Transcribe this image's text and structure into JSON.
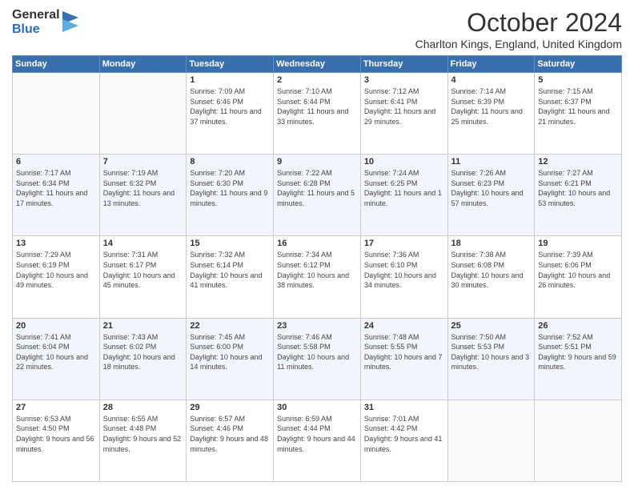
{
  "logo": {
    "general": "General",
    "blue": "Blue"
  },
  "header": {
    "month": "October 2024",
    "location": "Charlton Kings, England, United Kingdom"
  },
  "days": [
    "Sunday",
    "Monday",
    "Tuesday",
    "Wednesday",
    "Thursday",
    "Friday",
    "Saturday"
  ],
  "weeks": [
    [
      {
        "day": "",
        "sunrise": "",
        "sunset": "",
        "daylight": ""
      },
      {
        "day": "",
        "sunrise": "",
        "sunset": "",
        "daylight": ""
      },
      {
        "day": "1",
        "sunrise": "Sunrise: 7:09 AM",
        "sunset": "Sunset: 6:46 PM",
        "daylight": "Daylight: 11 hours and 37 minutes."
      },
      {
        "day": "2",
        "sunrise": "Sunrise: 7:10 AM",
        "sunset": "Sunset: 6:44 PM",
        "daylight": "Daylight: 11 hours and 33 minutes."
      },
      {
        "day": "3",
        "sunrise": "Sunrise: 7:12 AM",
        "sunset": "Sunset: 6:41 PM",
        "daylight": "Daylight: 11 hours and 29 minutes."
      },
      {
        "day": "4",
        "sunrise": "Sunrise: 7:14 AM",
        "sunset": "Sunset: 6:39 PM",
        "daylight": "Daylight: 11 hours and 25 minutes."
      },
      {
        "day": "5",
        "sunrise": "Sunrise: 7:15 AM",
        "sunset": "Sunset: 6:37 PM",
        "daylight": "Daylight: 11 hours and 21 minutes."
      }
    ],
    [
      {
        "day": "6",
        "sunrise": "Sunrise: 7:17 AM",
        "sunset": "Sunset: 6:34 PM",
        "daylight": "Daylight: 11 hours and 17 minutes."
      },
      {
        "day": "7",
        "sunrise": "Sunrise: 7:19 AM",
        "sunset": "Sunset: 6:32 PM",
        "daylight": "Daylight: 11 hours and 13 minutes."
      },
      {
        "day": "8",
        "sunrise": "Sunrise: 7:20 AM",
        "sunset": "Sunset: 6:30 PM",
        "daylight": "Daylight: 11 hours and 9 minutes."
      },
      {
        "day": "9",
        "sunrise": "Sunrise: 7:22 AM",
        "sunset": "Sunset: 6:28 PM",
        "daylight": "Daylight: 11 hours and 5 minutes."
      },
      {
        "day": "10",
        "sunrise": "Sunrise: 7:24 AM",
        "sunset": "Sunset: 6:25 PM",
        "daylight": "Daylight: 11 hours and 1 minute."
      },
      {
        "day": "11",
        "sunrise": "Sunrise: 7:26 AM",
        "sunset": "Sunset: 6:23 PM",
        "daylight": "Daylight: 10 hours and 57 minutes."
      },
      {
        "day": "12",
        "sunrise": "Sunrise: 7:27 AM",
        "sunset": "Sunset: 6:21 PM",
        "daylight": "Daylight: 10 hours and 53 minutes."
      }
    ],
    [
      {
        "day": "13",
        "sunrise": "Sunrise: 7:29 AM",
        "sunset": "Sunset: 6:19 PM",
        "daylight": "Daylight: 10 hours and 49 minutes."
      },
      {
        "day": "14",
        "sunrise": "Sunrise: 7:31 AM",
        "sunset": "Sunset: 6:17 PM",
        "daylight": "Daylight: 10 hours and 45 minutes."
      },
      {
        "day": "15",
        "sunrise": "Sunrise: 7:32 AM",
        "sunset": "Sunset: 6:14 PM",
        "daylight": "Daylight: 10 hours and 41 minutes."
      },
      {
        "day": "16",
        "sunrise": "Sunrise: 7:34 AM",
        "sunset": "Sunset: 6:12 PM",
        "daylight": "Daylight: 10 hours and 38 minutes."
      },
      {
        "day": "17",
        "sunrise": "Sunrise: 7:36 AM",
        "sunset": "Sunset: 6:10 PM",
        "daylight": "Daylight: 10 hours and 34 minutes."
      },
      {
        "day": "18",
        "sunrise": "Sunrise: 7:38 AM",
        "sunset": "Sunset: 6:08 PM",
        "daylight": "Daylight: 10 hours and 30 minutes."
      },
      {
        "day": "19",
        "sunrise": "Sunrise: 7:39 AM",
        "sunset": "Sunset: 6:06 PM",
        "daylight": "Daylight: 10 hours and 26 minutes."
      }
    ],
    [
      {
        "day": "20",
        "sunrise": "Sunrise: 7:41 AM",
        "sunset": "Sunset: 6:04 PM",
        "daylight": "Daylight: 10 hours and 22 minutes."
      },
      {
        "day": "21",
        "sunrise": "Sunrise: 7:43 AM",
        "sunset": "Sunset: 6:02 PM",
        "daylight": "Daylight: 10 hours and 18 minutes."
      },
      {
        "day": "22",
        "sunrise": "Sunrise: 7:45 AM",
        "sunset": "Sunset: 6:00 PM",
        "daylight": "Daylight: 10 hours and 14 minutes."
      },
      {
        "day": "23",
        "sunrise": "Sunrise: 7:46 AM",
        "sunset": "Sunset: 5:58 PM",
        "daylight": "Daylight: 10 hours and 11 minutes."
      },
      {
        "day": "24",
        "sunrise": "Sunrise: 7:48 AM",
        "sunset": "Sunset: 5:55 PM",
        "daylight": "Daylight: 10 hours and 7 minutes."
      },
      {
        "day": "25",
        "sunrise": "Sunrise: 7:50 AM",
        "sunset": "Sunset: 5:53 PM",
        "daylight": "Daylight: 10 hours and 3 minutes."
      },
      {
        "day": "26",
        "sunrise": "Sunrise: 7:52 AM",
        "sunset": "Sunset: 5:51 PM",
        "daylight": "Daylight: 9 hours and 59 minutes."
      }
    ],
    [
      {
        "day": "27",
        "sunrise": "Sunrise: 6:53 AM",
        "sunset": "Sunset: 4:50 PM",
        "daylight": "Daylight: 9 hours and 56 minutes."
      },
      {
        "day": "28",
        "sunrise": "Sunrise: 6:55 AM",
        "sunset": "Sunset: 4:48 PM",
        "daylight": "Daylight: 9 hours and 52 minutes."
      },
      {
        "day": "29",
        "sunrise": "Sunrise: 6:57 AM",
        "sunset": "Sunset: 4:46 PM",
        "daylight": "Daylight: 9 hours and 48 minutes."
      },
      {
        "day": "30",
        "sunrise": "Sunrise: 6:59 AM",
        "sunset": "Sunset: 4:44 PM",
        "daylight": "Daylight: 9 hours and 44 minutes."
      },
      {
        "day": "31",
        "sunrise": "Sunrise: 7:01 AM",
        "sunset": "Sunset: 4:42 PM",
        "daylight": "Daylight: 9 hours and 41 minutes."
      },
      {
        "day": "",
        "sunrise": "",
        "sunset": "",
        "daylight": ""
      },
      {
        "day": "",
        "sunrise": "",
        "sunset": "",
        "daylight": ""
      }
    ]
  ]
}
